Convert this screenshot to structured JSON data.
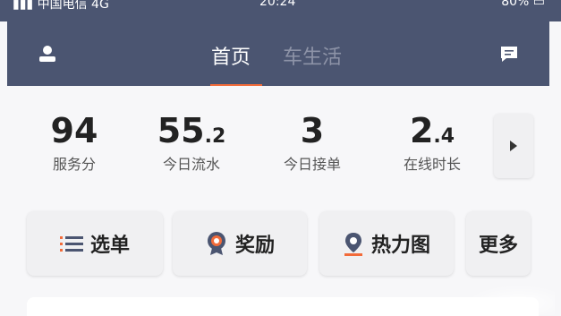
{
  "status_bar": {
    "carrier": "中国电信",
    "network": "4G",
    "time": "20:24",
    "battery": "80%"
  },
  "header": {
    "tabs": [
      {
        "label": "首页",
        "active": true
      },
      {
        "label": "车生活",
        "active": false
      }
    ],
    "icons": {
      "left": "user-icon",
      "right": "message-icon"
    },
    "colors": {
      "background": "#4b5571",
      "tab_active": "#ffffff",
      "tab_inactive": "#8d93a7",
      "underline": "#f26b3a"
    }
  },
  "stats": [
    {
      "value": "94",
      "unit": "",
      "label": "服务分"
    },
    {
      "value": "55",
      "unit": ".2",
      "label": "今日流水"
    },
    {
      "value": "3",
      "unit": "",
      "label": "今日接单"
    },
    {
      "value": "2",
      "unit": ".4",
      "label": "在线时长"
    }
  ],
  "actions": [
    {
      "label": "选单",
      "icon": "list-icon"
    },
    {
      "label": "奖励",
      "icon": "award-icon"
    },
    {
      "label": "热力图",
      "icon": "map-pin-icon"
    },
    {
      "label": "更多",
      "icon": ""
    }
  ],
  "accent_colors": {
    "award": "#f26b3a",
    "list": "#4b5571"
  }
}
